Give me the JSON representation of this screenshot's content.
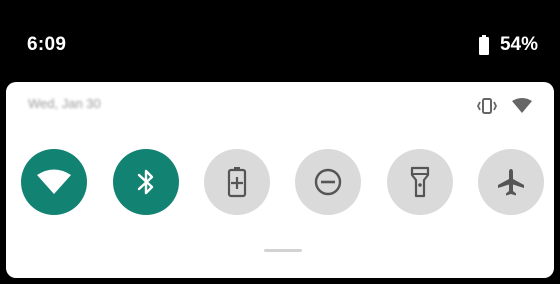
{
  "status_bar": {
    "time": "6:09",
    "battery_percent": "54%",
    "battery_level": 0.54
  },
  "panel": {
    "date": "Wed, Jan 30"
  },
  "quick_settings": {
    "tiles": [
      {
        "icon": "wifi-icon",
        "state": "on"
      },
      {
        "icon": "bluetooth-icon",
        "state": "on"
      },
      {
        "icon": "battery-saver-icon",
        "state": "off"
      },
      {
        "icon": "do-not-disturb-icon",
        "state": "off"
      },
      {
        "icon": "flashlight-icon",
        "state": "off"
      },
      {
        "icon": "airplane-mode-icon",
        "state": "off"
      }
    ]
  },
  "colors": {
    "tile_on": "#128272",
    "tile_off": "#dadada",
    "icon_on": "#ffffff",
    "icon_off": "#555555",
    "panel_bg": "#ffffff"
  }
}
